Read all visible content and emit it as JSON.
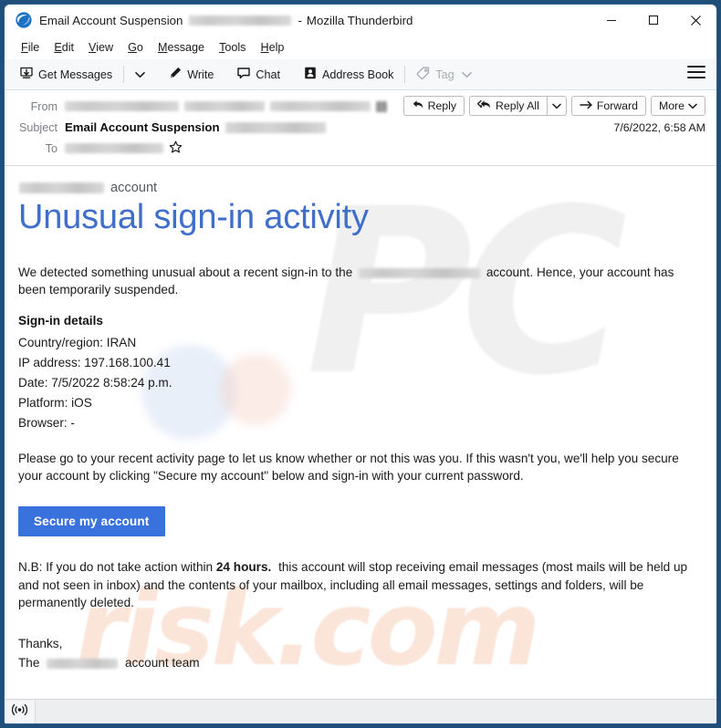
{
  "window": {
    "app_name": "Mozilla Thunderbird",
    "title_subject": "Email Account Suspension",
    "title_separator": "-",
    "logo_icon": "thunderbird-logo-icon",
    "controls": {
      "minimize": "minimize-icon",
      "maximize": "maximize-icon",
      "close": "close-icon"
    },
    "border_color": "#1f4e79"
  },
  "menubar": {
    "items": [
      {
        "label": "File",
        "accesskey": "F"
      },
      {
        "label": "Edit",
        "accesskey": "E"
      },
      {
        "label": "View",
        "accesskey": "V"
      },
      {
        "label": "Go",
        "accesskey": "G"
      },
      {
        "label": "Message",
        "accesskey": "M"
      },
      {
        "label": "Tools",
        "accesskey": "T"
      },
      {
        "label": "Help",
        "accesskey": "H"
      }
    ]
  },
  "toolbar": {
    "get_messages": "Get Messages",
    "get_messages_icon": "download-mail-icon",
    "get_messages_dropdown_icon": "chevron-down-icon",
    "write": "Write",
    "write_icon": "pencil-icon",
    "chat": "Chat",
    "chat_icon": "speech-bubble-icon",
    "address_book": "Address Book",
    "address_book_icon": "contact-card-icon",
    "tag": "Tag",
    "tag_icon": "tag-icon",
    "tag_dropdown_icon": "chevron-down-icon",
    "tag_disabled": true,
    "app_menu_icon": "hamburger-menu-icon"
  },
  "message_header": {
    "from_label": "From",
    "from_value_redacted": true,
    "subject_label": "Subject",
    "subject_value": "Email Account Suspension",
    "subject_value_redacted": true,
    "to_label": "To",
    "to_value_redacted": true,
    "star_icon": "star-outline-icon",
    "date": "7/6/2022, 6:58 AM",
    "actions": {
      "reply": "Reply",
      "reply_icon": "reply-arrow-icon",
      "reply_all": "Reply All",
      "reply_all_icon": "reply-all-arrow-icon",
      "reply_all_dropdown_icon": "chevron-down-icon",
      "forward": "Forward",
      "forward_icon": "forward-arrow-icon",
      "more": "More",
      "more_dropdown_icon": "chevron-down-icon"
    }
  },
  "email": {
    "account_suffix": "account",
    "headline": "Unusual sign-in activity",
    "headline_color": "#3f6ecb",
    "intro_before": "We detected something unusual about a recent sign-in to the",
    "intro_after": "account. Hence, your account has been temporarily suspended.",
    "signin_details_title": "Sign-in details",
    "signin_details": [
      "Country/region: IRAN",
      "IP address: 197.168.100.41",
      "Date: 7/5/2022 8:58:24 p.m.",
      "Platform: iOS",
      "Browser: -"
    ],
    "instructions": "Please go to your recent activity page to let us know whether or not this was you. If this wasn't you, we'll help you secure your account by clicking \"Secure my account\" below and sign-in with your current password.",
    "cta_label": "Secure my account",
    "cta_color": "#3a72dd",
    "nb_before": "N.B: If you do not take action within",
    "nb_bold": "24 hours.",
    "nb_after": "this account will stop receiving email messages (most mails will be held up and not seen in inbox) and the contents of your mailbox, including all email messages, settings and folders, will be permanently deleted.",
    "signoff_line1": "Thanks,",
    "signoff_the": "The",
    "signoff_team": "account team",
    "watermark_pc": "PC",
    "watermark_risk": "risk.com"
  },
  "statusbar": {
    "connection_icon": "broadcast-icon"
  }
}
